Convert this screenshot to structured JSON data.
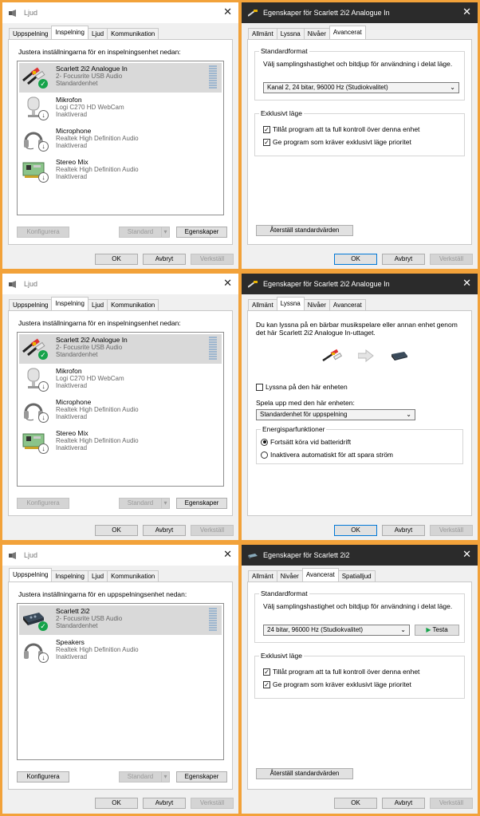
{
  "titles": {
    "sound": "Ljud",
    "props_in": "Egenskaper för Scarlett 2i2 Analogue In",
    "props_out": "Egenskaper för Scarlett 2i2"
  },
  "close_glyph": "✕",
  "sound_tabs": [
    "Uppspelning",
    "Inspelning",
    "Ljud",
    "Kommunikation"
  ],
  "props_in_tabs": [
    "Allmänt",
    "Lyssna",
    "Nivåer",
    "Avancerat"
  ],
  "props_out_tabs": [
    "Allmänt",
    "Nivåer",
    "Avancerat",
    "Spatialljud"
  ],
  "instr_recording": "Justera inställningarna för en inspelningsenhet nedan:",
  "instr_playback": "Justera inställningarna för en uppspelningsenhet nedan:",
  "recording_devices": [
    {
      "name": "Scarlett 2i2 Analogue In",
      "driver": "2- Focusrite USB Audio",
      "status": "Standardenhet",
      "icon": "rca-cable-icon"
    },
    {
      "name": "Mikrofon",
      "driver": "Logi C270 HD WebCam",
      "status": "Inaktiverad",
      "icon": "webcam-mic-icon"
    },
    {
      "name": "Microphone",
      "driver": "Realtek High Definition Audio",
      "status": "Inaktiverad",
      "icon": "headset-icon"
    },
    {
      "name": "Stereo Mix",
      "driver": "Realtek High Definition Audio",
      "status": "Inaktiverad",
      "icon": "sound-card-icon"
    }
  ],
  "playback_devices": [
    {
      "name": "Scarlett 2i2",
      "driver": "2- Focusrite USB Audio",
      "status": "Standardenhet",
      "icon": "audio-interface-icon"
    },
    {
      "name": "Speakers",
      "driver": "Realtek High Definition Audio",
      "status": "Inaktiverad",
      "icon": "headphones-icon"
    }
  ],
  "buttons": {
    "configure": "Konfigurera",
    "default": "Standard",
    "properties": "Egenskaper",
    "ok": "OK",
    "cancel": "Avbryt",
    "apply": "Verkställ",
    "restore": "Återställ standardvärden",
    "test": "Testa"
  },
  "advanced": {
    "format_label": "Standardformat",
    "format_desc": "Välj samplingshastighet och bitdjup för användning i delat läge.",
    "format_in": "Kanal 2, 24 bitar, 96000 Hz (Studiokvalitet)",
    "format_out": "24 bitar, 96000 Hz (Studiokvalitet)",
    "exclusive_label": "Exklusivt läge",
    "exclusive_allow": "Tillåt program att ta full kontroll över denna enhet",
    "exclusive_priority": "Ge program som kräver exklusivt läge prioritet"
  },
  "listen": {
    "desc1": "Du kan lyssna på en bärbar musikspelare eller annan enhet genom",
    "desc2": "det här Scarlett 2i2 Analogue In-uttaget.",
    "listen_checkbox": "Lyssna på den här enheten",
    "playback_label": "Spela upp med den här enheten:",
    "playback_value": "Standardenhet för uppspelning",
    "power_label": "Energisparfunktioner",
    "power_opt1": "Fortsätt köra vid batteridrift",
    "power_opt2": "Inaktivera automatiskt för att spara ström"
  },
  "colors": {
    "background_accent": "#f2a23a",
    "ok_badge": "#16a34a",
    "selection": "#d9d9d9"
  }
}
